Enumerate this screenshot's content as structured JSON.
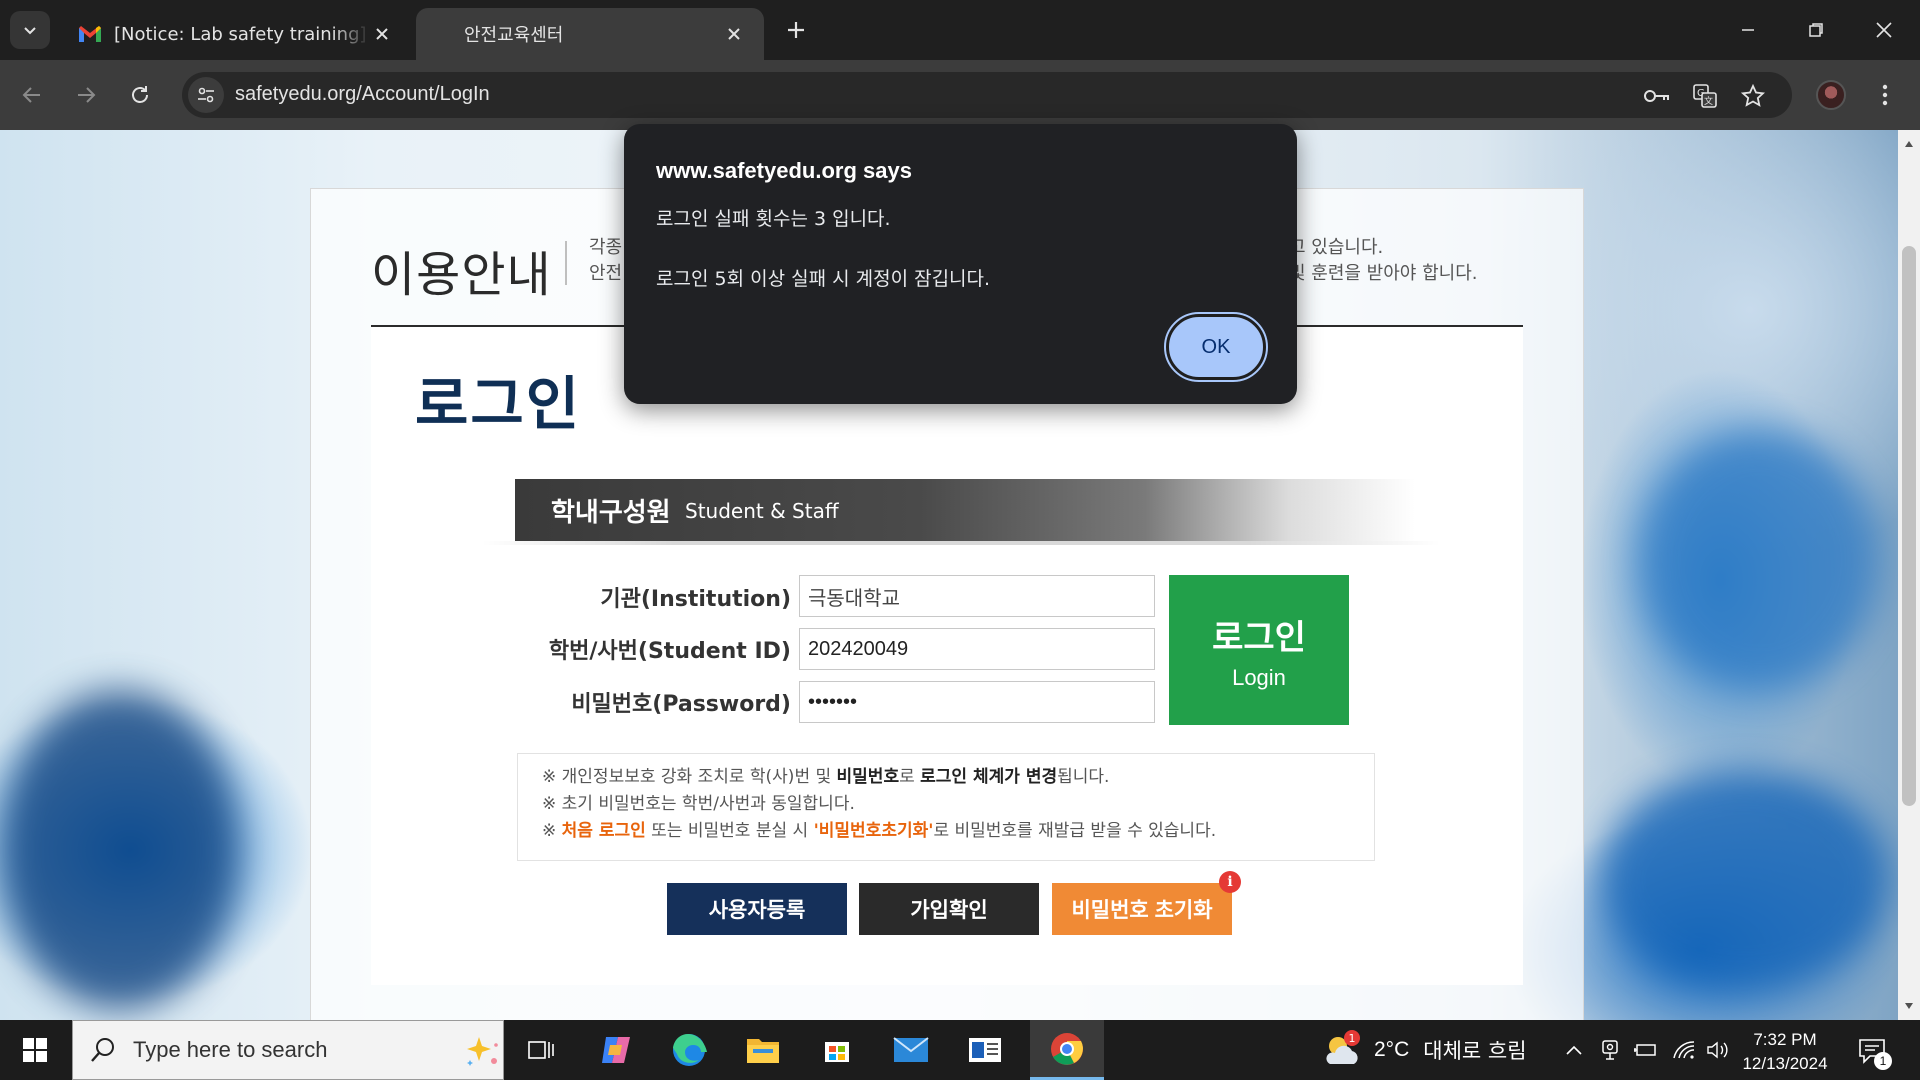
{
  "browser": {
    "tabs": [
      {
        "title": "[Notice: Lab safety training] - nsc",
        "active": false
      },
      {
        "title": "안전교육센터",
        "active": true
      }
    ],
    "url": "safetyedu.org/Account/LogIn"
  },
  "page": {
    "info_title": "이용안내",
    "info_lines": {
      "line1_left": "각종",
      "line1_right": "고 있습니다.",
      "line2_left": "안전",
      "line2_right": "및 훈련을 받아야 합니다."
    },
    "login_title": "로그인",
    "band": {
      "ko": "학내구성원",
      "en": "Student & Staff"
    },
    "form": {
      "institution_label": "기관(Institution)",
      "institution_value": "극동대학교",
      "student_id_label": "학번/사번(Student ID)",
      "student_id_value": "202420049",
      "password_label": "비밀번호(Password)",
      "password_value": "•••••••"
    },
    "login_button": {
      "ko": "로그인",
      "en": "Login"
    },
    "notice": {
      "l1_a": "※ 개인정보보호 강화 조치로 학(사)번 및 ",
      "l1_b": "비밀번호",
      "l1_c": "로 ",
      "l1_d": "로그인 체계가 변경",
      "l1_e": "됩니다.",
      "l2": "※ 초기 비밀번호는 학번/사번과 동일합니다.",
      "l3_a": "※ ",
      "l3_b": "처음 로그인",
      "l3_c": " 또는 비밀번호 분실 시 ",
      "l3_d": "'비밀번호초기화'",
      "l3_e": "로 비밀번호를 재발급 받을 수 있습니다."
    },
    "buttons": {
      "register": "사용자등록",
      "confirm": "가입확인",
      "reset": "비밀번호 초기화",
      "reset_badge": "i"
    }
  },
  "dialog": {
    "title": "www.safetyedu.org says",
    "line1": "로그인 실패 횟수는 3 입니다.",
    "line2": "로그인 5회 이상 실패 시 계정이 잠깁니다.",
    "ok": "OK"
  },
  "taskbar": {
    "search_placeholder": "Type here to search",
    "weather_temp": "2°C",
    "weather_cond": "대체로 흐림",
    "weather_badge": "1",
    "time": "7:32 PM",
    "date": "12/13/2024",
    "notif_count": "1"
  },
  "colors": {
    "login_green": "#22a04a",
    "navy": "#15305a",
    "orange": "#f08a35",
    "dialog_ok": "#a8c7fa"
  }
}
